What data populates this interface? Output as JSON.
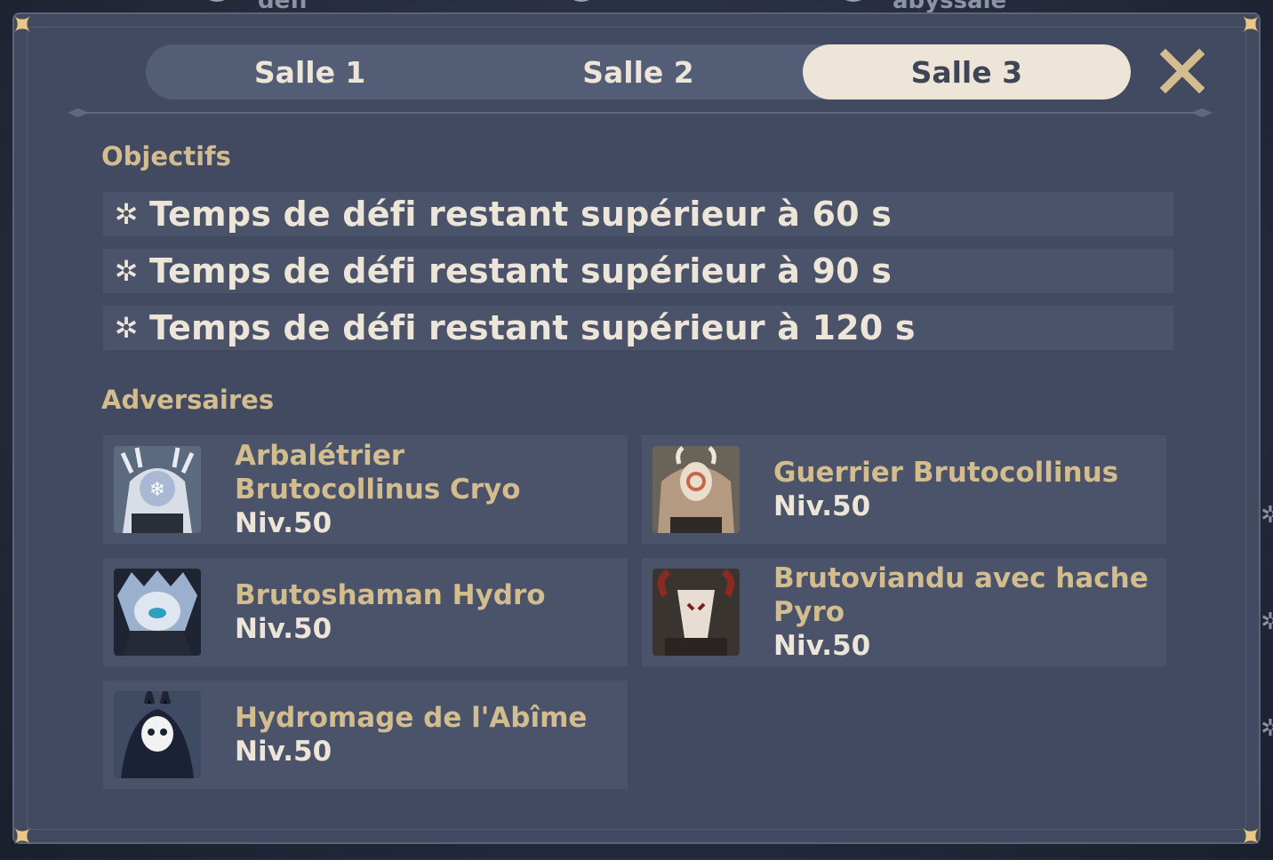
{
  "background": {
    "labels": [
      "défi",
      "abyssale"
    ]
  },
  "tabs": [
    {
      "label": "Salle 1",
      "active": false
    },
    {
      "label": "Salle 2",
      "active": false
    },
    {
      "label": "Salle 3",
      "active": true
    }
  ],
  "close": {
    "icon": "close-icon"
  },
  "objectives": {
    "title": "Objectifs",
    "items": [
      {
        "icon": "star-icon",
        "text": "Temps de défi restant supérieur à 60 s"
      },
      {
        "icon": "star-icon",
        "text": "Temps de défi restant supérieur à 90 s"
      },
      {
        "icon": "star-icon",
        "text": "Temps de défi restant supérieur à 120 s"
      }
    ]
  },
  "adversaries": {
    "title": "Adversaires",
    "items": [
      {
        "name": "Arbalétrier Brutocollinus Cryo",
        "level": "Niv.50",
        "icon": "cryo-hilichurl-shooter-icon"
      },
      {
        "name": "Guerrier Brutocollinus",
        "level": "Niv.50",
        "icon": "hilichurl-fighter-icon"
      },
      {
        "name": "Brutoshaman Hydro",
        "level": "Niv.50",
        "icon": "hydro-samachurl-icon"
      },
      {
        "name": "Brutoviandu avec hache Pyro",
        "level": "Niv.50",
        "icon": "pyro-mitachurl-icon"
      },
      {
        "name": "Hydromage de l'Abîme",
        "level": "Niv.50",
        "icon": "abyss-mage-icon"
      }
    ]
  },
  "colors": {
    "accent": "#d3bc8e",
    "text": "#ece5d8",
    "panel": "#414a61",
    "row": "#4a5369"
  }
}
